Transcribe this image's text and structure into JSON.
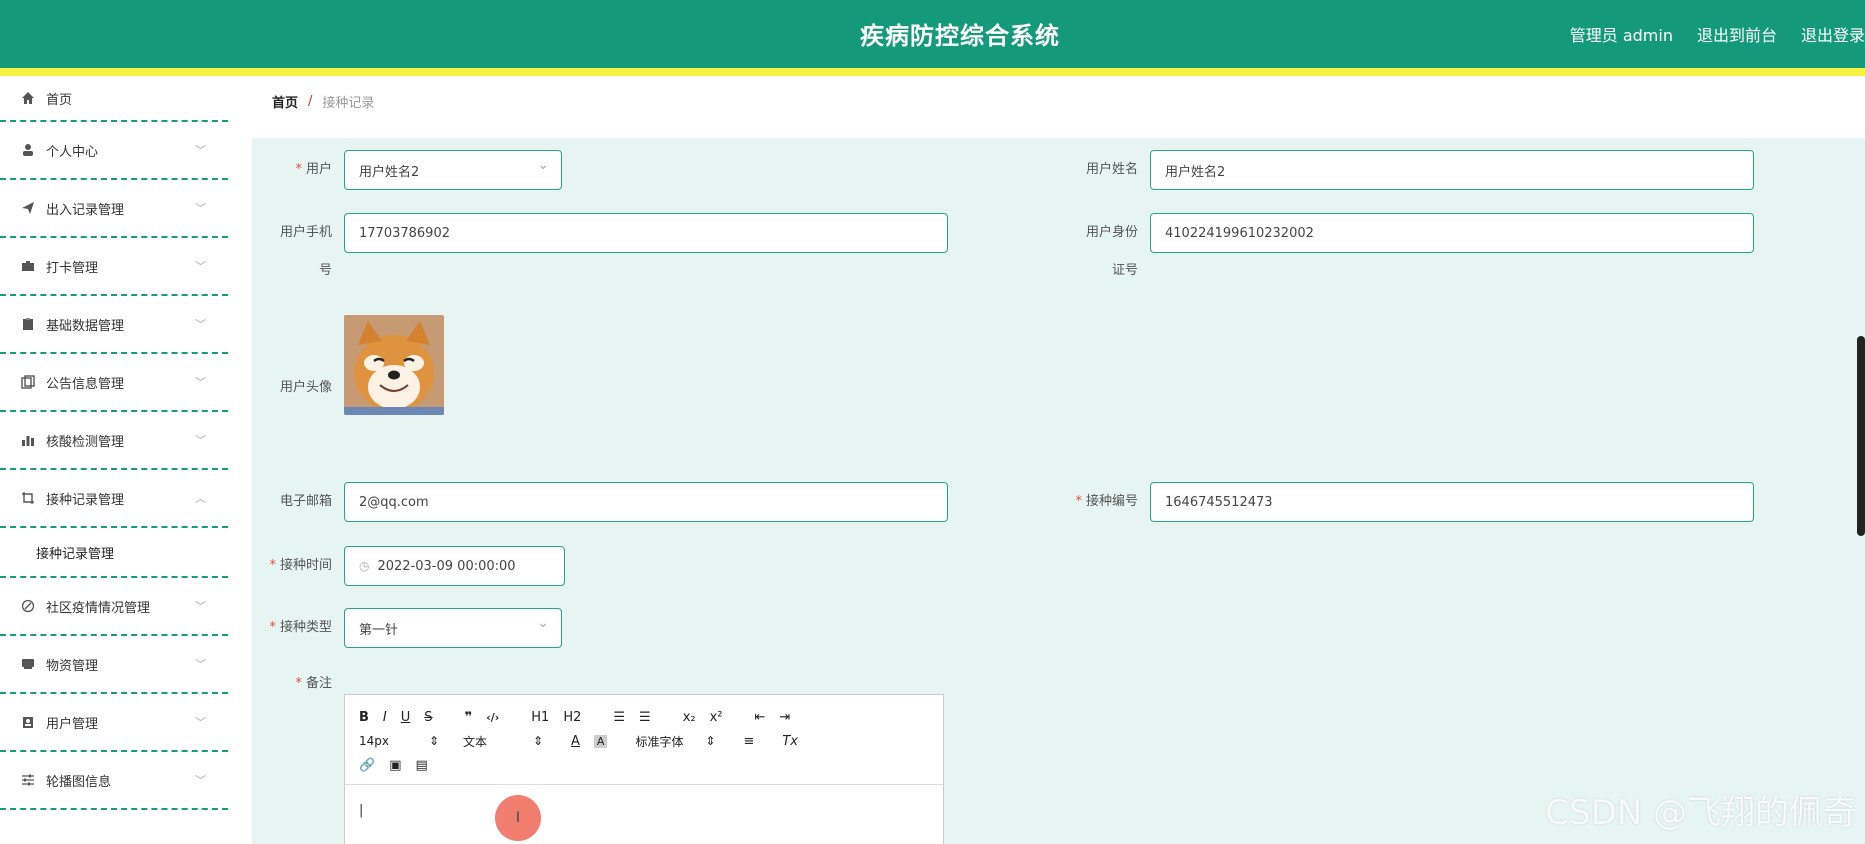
{
  "header": {
    "title": "疾病防控综合系统",
    "admin_label": "管理员 admin",
    "exit_front": "退出到前台",
    "logout": "退出登录"
  },
  "sidebar": {
    "items": [
      {
        "label": "首页",
        "icon": "home-icon"
      },
      {
        "label": "个人中心",
        "icon": "user-icon"
      },
      {
        "label": "出入记录管理",
        "icon": "send-icon"
      },
      {
        "label": "打卡管理",
        "icon": "briefcase-icon"
      },
      {
        "label": "基础数据管理",
        "icon": "clipboard-icon"
      },
      {
        "label": "公告信息管理",
        "icon": "copy-icon"
      },
      {
        "label": "核酸检测管理",
        "icon": "chart-icon"
      },
      {
        "label": "接种记录管理",
        "icon": "crop-icon"
      },
      {
        "label": "社区疫情情况管理",
        "icon": "compass-icon"
      },
      {
        "label": "物资管理",
        "icon": "box-icon"
      },
      {
        "label": "用户管理",
        "icon": "clipboard-user-icon"
      },
      {
        "label": "轮播图信息",
        "icon": "sliders-icon"
      }
    ],
    "sub_item": "接种记录管理"
  },
  "breadcrumb": {
    "home": "首页",
    "sep": "/",
    "current": "接种记录"
  },
  "form": {
    "user_label": "用户",
    "user_value": "用户姓名2",
    "username_label": "用户姓名",
    "username_value": "用户姓名2",
    "phone_label_1": "用户手机",
    "phone_label_2": "号",
    "phone_value": "17703786902",
    "idcard_label_1": "用户身份",
    "idcard_label_2": "证号",
    "idcard_value": "410224199610232002",
    "avatar_label": "用户头像",
    "email_label": "电子邮箱",
    "email_value": "2@qq.com",
    "vaccine_no_label": "接种编号",
    "vaccine_no_value": "1646745512473",
    "vaccine_time_label": "接种时间",
    "vaccine_time_value": "2022-03-09 00:00:00",
    "vaccine_type_label": "接种类型",
    "vaccine_type_value": "第一针",
    "remark_label": "备注"
  },
  "editor": {
    "font_size": "14px",
    "block_type": "文本",
    "font_family": "标准字体",
    "buttons_row1": [
      "B",
      "I",
      "U",
      "S",
      "❞",
      "</>",
      "H1",
      "H2"
    ],
    "sub": "x₂",
    "sup": "x²",
    "clear": "Tx"
  },
  "watermark": "CSDN @飞翔的佩奇"
}
